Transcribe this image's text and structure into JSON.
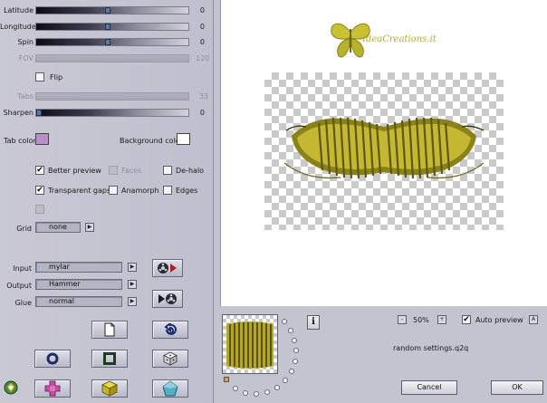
{
  "sliders": [
    {
      "label": "Latitude",
      "value": "0",
      "pos": 0.47,
      "enabled": true
    },
    {
      "label": "Longitude",
      "value": "0",
      "pos": 0.47,
      "enabled": true
    },
    {
      "label": "Spin",
      "value": "0",
      "pos": 0.47,
      "enabled": true
    },
    {
      "label": "FOV",
      "value": "120",
      "pos": null,
      "enabled": false
    },
    {
      "label": "Tabs",
      "value": "33",
      "pos": null,
      "enabled": false
    },
    {
      "label": "Sharpen",
      "value": "0",
      "pos": 0.0,
      "enabled": true
    }
  ],
  "flip": {
    "label": "Flip",
    "checked": false
  },
  "colors": {
    "tab_color_label": "Tab color",
    "tab_color": "#b493c4",
    "background_color_label": "Background color",
    "background_color": "#ffffff"
  },
  "options": {
    "better_preview": {
      "label": "Better preview",
      "checked": true
    },
    "faces": {
      "label": "Faces",
      "checked": false
    },
    "de_halo": {
      "label": "De-halo",
      "checked": false
    },
    "transparent_gaps": {
      "label": "Transparent gaps",
      "checked": true
    },
    "anamorph": {
      "label": "Anamorph",
      "checked": false
    },
    "edges": {
      "label": "Edges",
      "checked": false
    }
  },
  "grid": {
    "label": "Grid",
    "value": "none"
  },
  "io": {
    "input_label": "Input",
    "input_value": "mylar",
    "output_label": "Output",
    "output_value": "Hammer",
    "glue_label": "Glue",
    "glue_value": "normal"
  },
  "preview": {
    "watermark_text": "IdeaCreations.it",
    "zoom_value": "50%",
    "zoom_minus": "-",
    "zoom_plus": "+",
    "auto_preview_label": "Auto preview",
    "auto_preview_checked": true,
    "settings_file": "random settings.q2q",
    "info_label": "i",
    "auto_a_label": "A"
  },
  "dialog": {
    "cancel_label": "Cancel",
    "ok_label": "OK"
  },
  "icons": {
    "accent_purple": "#c64fa6",
    "accent_yellow": "#c8b520",
    "accent_teal": "#4fb0c8",
    "accent_olive": "#a99b1a"
  }
}
